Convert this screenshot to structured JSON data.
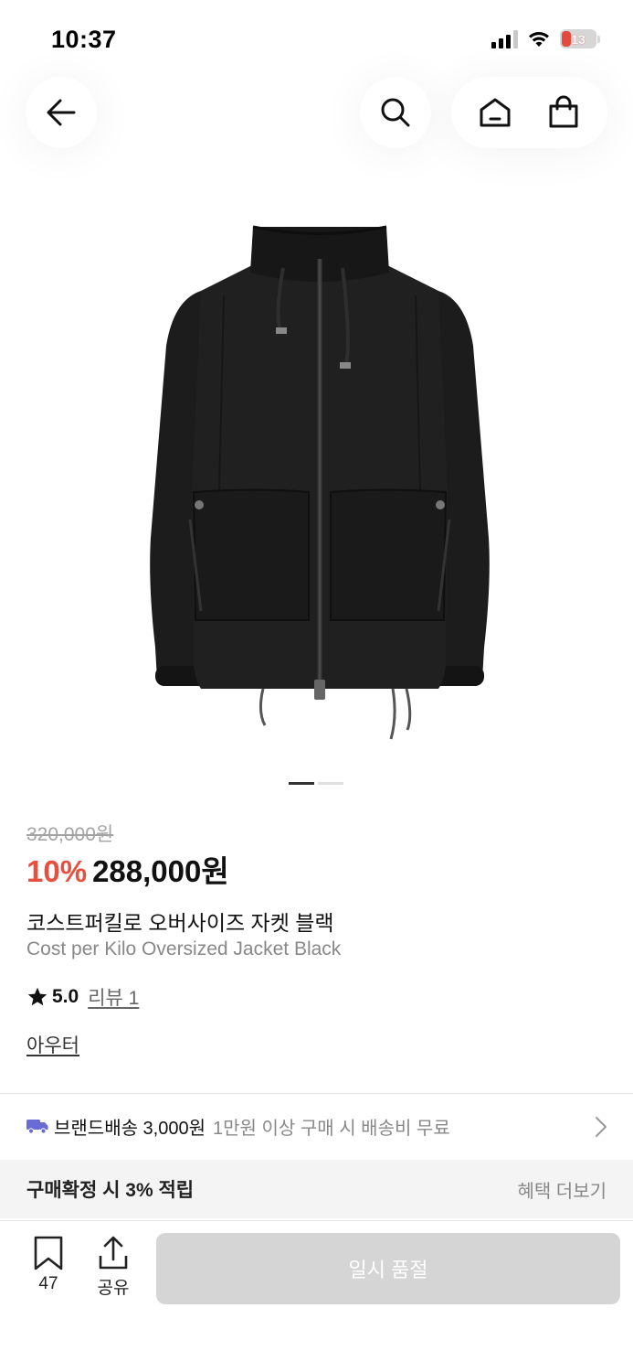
{
  "status_bar": {
    "time": "10:37",
    "battery": "13"
  },
  "nav": {
    "back_icon": "arrow-left-icon",
    "search_icon": "search-icon",
    "home_icon": "home-icon",
    "cart_icon": "shopping-bag-icon"
  },
  "carousel": {
    "total": 2,
    "active": 1
  },
  "product": {
    "original_price": "320,000원",
    "discount": "10%",
    "sale_price": "288,000원",
    "name_ko": "코스트퍼킬로 오버사이즈 자켓 블랙",
    "name_en": "Cost per Kilo Oversized Jacket Black",
    "rating": "5.0",
    "review_label": "리뷰 1",
    "category": "아우터"
  },
  "shipping": {
    "label": "브랜드배송 3,000원",
    "note": "1만원 이상 구매 시 배송비 무료",
    "icon": "truck-icon",
    "icon_color": "#6b6bd6"
  },
  "benefit": {
    "text": "구매확정 시 3% 적립",
    "more": "혜택 더보기"
  },
  "bottom_bar": {
    "bookmark_count": "47",
    "share_label": "공유",
    "soldout_label": "일시 품절"
  },
  "colors": {
    "discount": "#e84f3d",
    "disabled_button": "#d5d5d5"
  }
}
